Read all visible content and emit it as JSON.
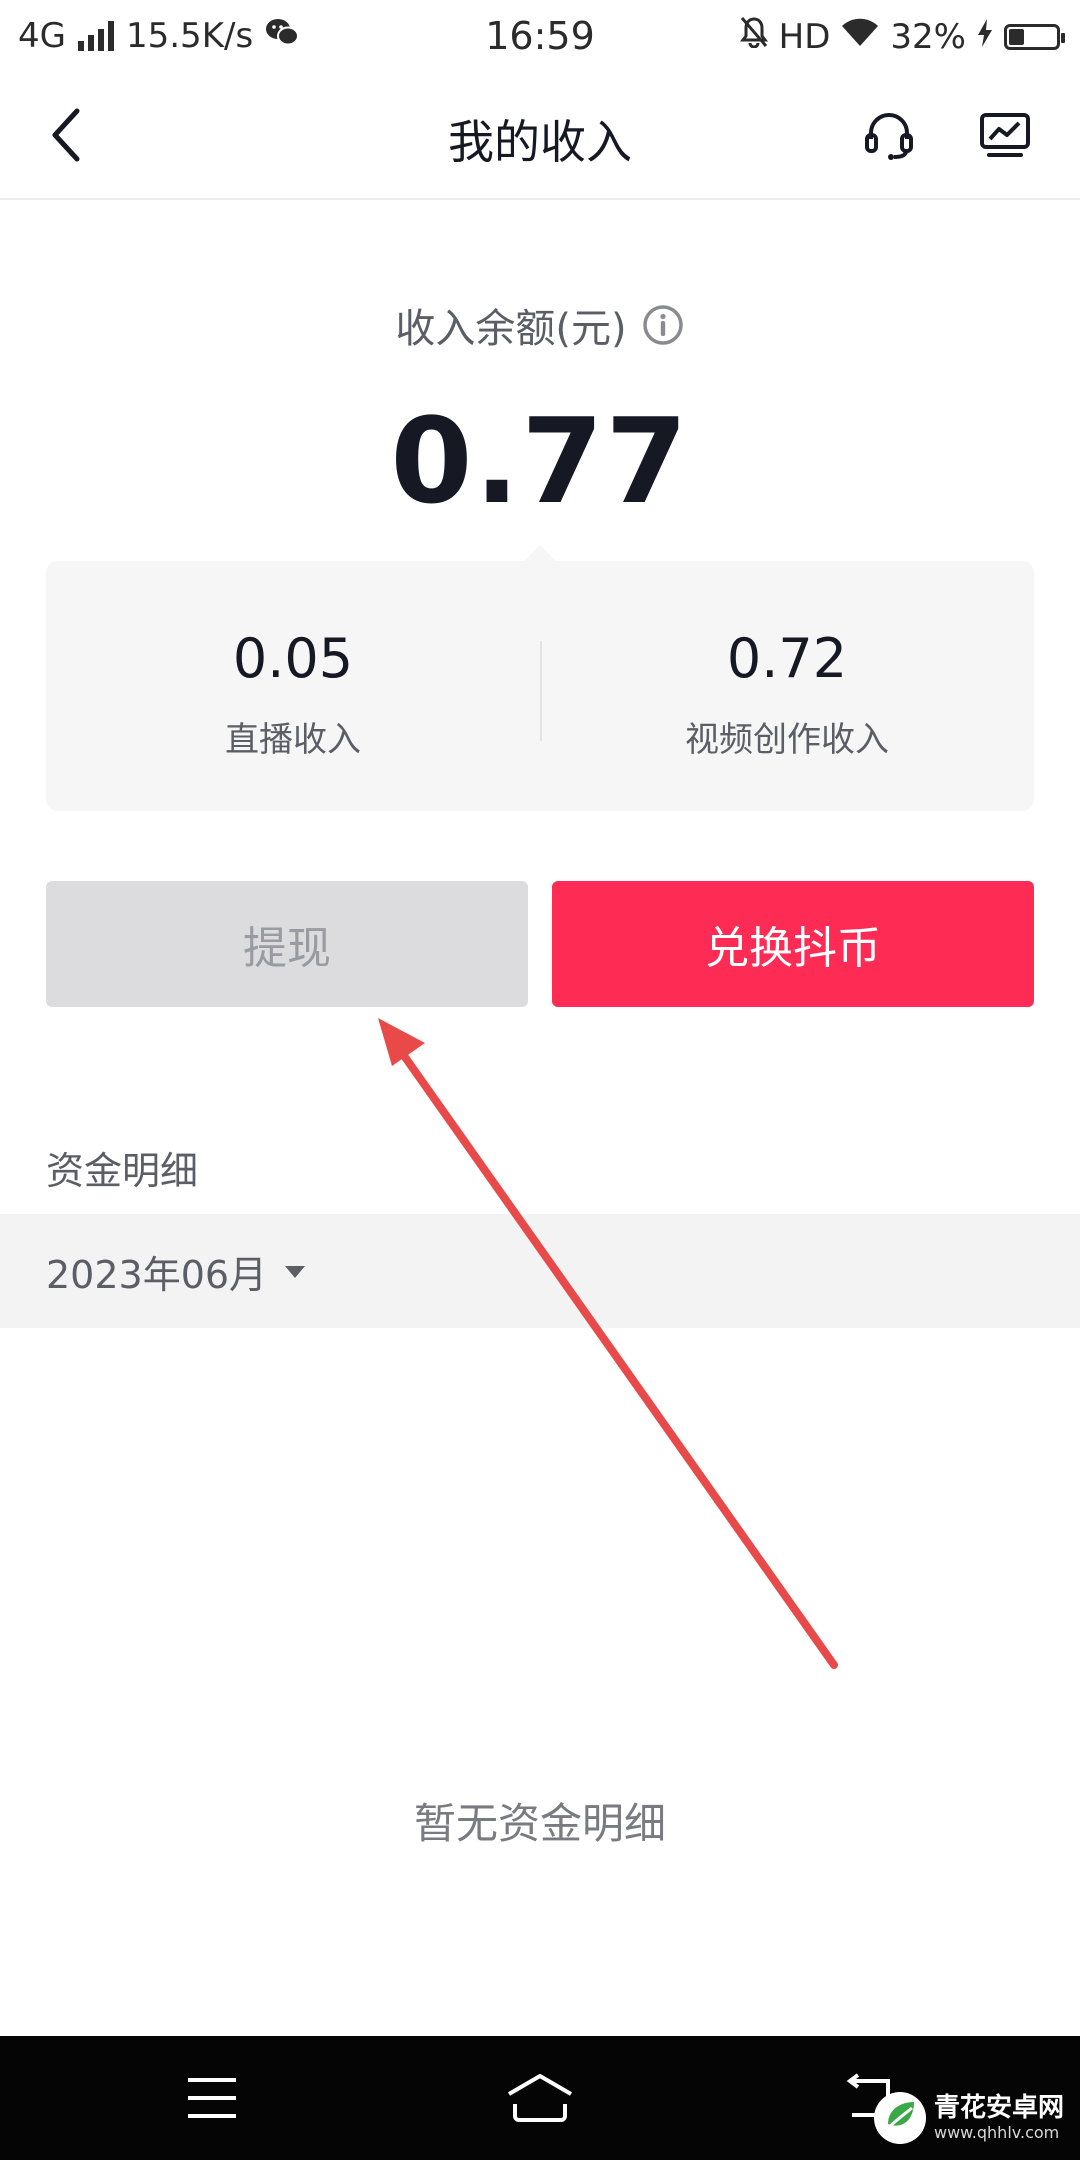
{
  "status_bar": {
    "network": "4G",
    "speed": "15.5K/s",
    "time": "16:59",
    "hd": "HD",
    "battery_percent": "32%",
    "battery_level": 0.32
  },
  "header": {
    "title": "我的收入"
  },
  "balance": {
    "label": "收入余额(元)",
    "amount": "0.77"
  },
  "breakdown": [
    {
      "value": "0.05",
      "label": "直播收入"
    },
    {
      "value": "0.72",
      "label": "视频创作收入"
    }
  ],
  "buttons": {
    "withdraw": "提现",
    "exchange": "兑换抖币"
  },
  "funds": {
    "title": "资金明细",
    "month": "2023年06月",
    "empty": "暂无资金明细"
  },
  "watermark": {
    "cn": "青花安卓网",
    "url": "www.qhhlv.com"
  },
  "colors": {
    "accent": "#fe2c55",
    "annotation_arrow": "#e84a4a"
  }
}
